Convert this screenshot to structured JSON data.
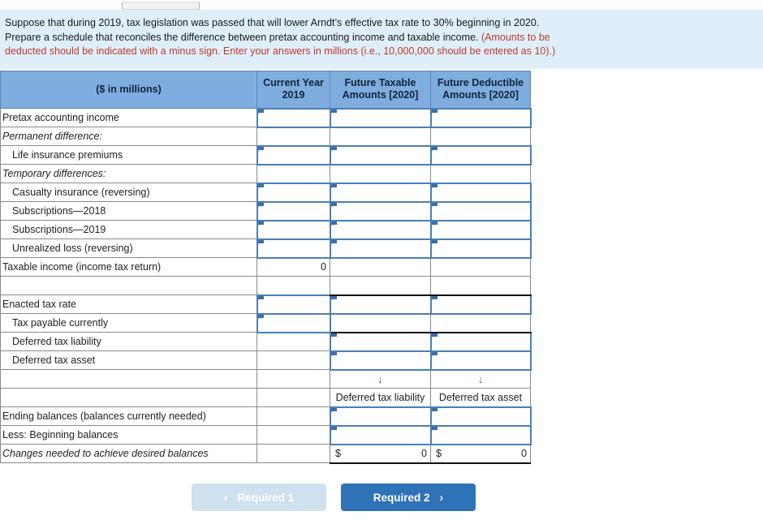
{
  "instructions": {
    "line1": "Suppose that during 2019, tax legislation was passed that will lower Arndt’s effective tax rate to 30% beginning in 2020.",
    "line2_black": "Prepare a schedule that reconciles the difference between pretax accounting income and taxable income.",
    "line2_red": "(Amounts to be",
    "line3_red": "deducted should be indicated with a minus sign. Enter your answers in millions (i.e., 10,000,000 should be entered as 10).)"
  },
  "table": {
    "headers": {
      "col0": "($ in millions)",
      "col1_line1": "Current Year",
      "col1_line2": "2019",
      "col2_line1": "Future Taxable",
      "col2_line2": "Amounts [2020]",
      "col3_line1": "Future Deductible",
      "col3_line2": "Amounts [2020]"
    },
    "rows": {
      "pretax_accounting_income": "Pretax accounting income",
      "permanent_difference": "Permanent difference:",
      "life_insurance_premiums": "Life insurance premiums",
      "temporary_differences": "Temporary differences:",
      "casualty_insurance": "Casualty insurance (reversing)",
      "subscriptions_2018": "Subscriptions—2018",
      "subscriptions_2019": "Subscriptions—2019",
      "unrealized_loss": "Unrealized loss (reversing)",
      "taxable_income": "Taxable income (income tax return)",
      "taxable_income_value": "0",
      "enacted_tax_rate": "Enacted tax rate",
      "tax_payable_currently": "Tax payable currently",
      "deferred_tax_liability": "Deferred tax liability",
      "deferred_tax_asset": "Deferred tax asset",
      "arrow_glyph": "↓",
      "subhead_liability": "Deferred tax liability",
      "subhead_asset": "Deferred tax asset",
      "ending_balances": "Ending balances (balances currently needed)",
      "less_beginning_balances": "Less: Beginning balances",
      "changes_needed": "Changes needed to achieve desired balances",
      "changes_liability_dollar": "$",
      "changes_liability_value": "0",
      "changes_asset_dollar": "$",
      "changes_asset_value": "0"
    }
  },
  "footer": {
    "prev_label": "Required 1",
    "prev_chevron": "‹",
    "next_label": "Required 2",
    "next_chevron": "›"
  }
}
